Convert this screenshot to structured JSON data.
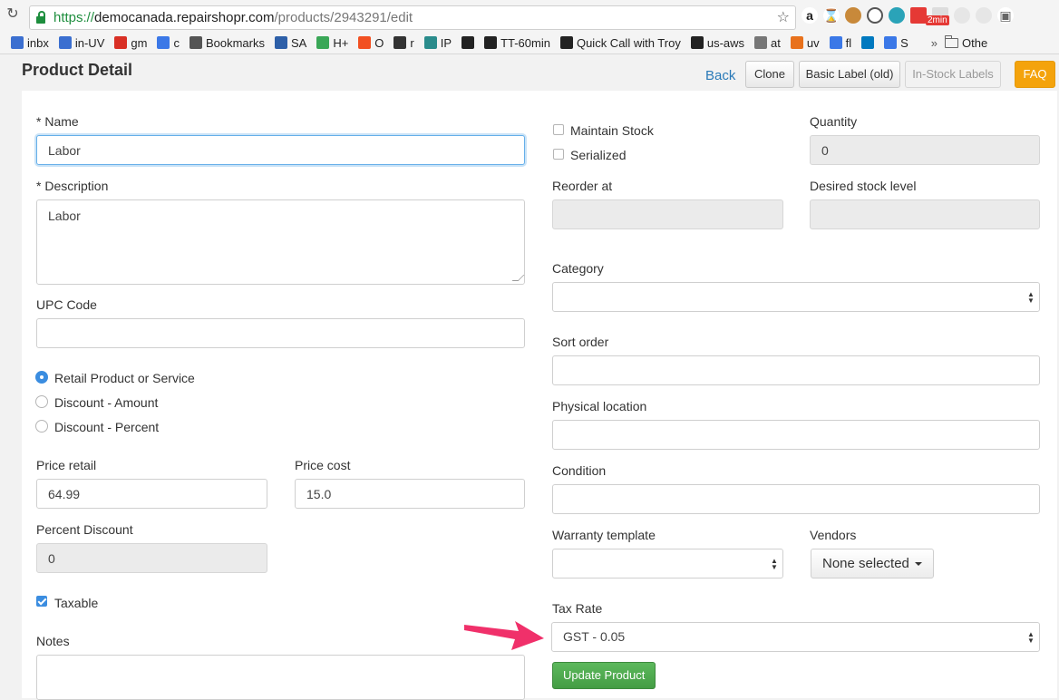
{
  "browser": {
    "url_scheme": "https://",
    "url_host": "democanada.repairshopr.com",
    "url_path": "/products/2943291/edit",
    "extension_badge": "2min",
    "bookmarks": [
      {
        "label": "inbx",
        "icon": "mail-icon",
        "color": "#3b6fd0"
      },
      {
        "label": "in-UV",
        "icon": "mail-icon",
        "color": "#3b6fd0"
      },
      {
        "label": "gm",
        "icon": "gmail-icon",
        "color": "#d93025"
      },
      {
        "label": "c",
        "icon": "calendar-icon",
        "color": "#3b78e7"
      },
      {
        "label": "Bookmarks",
        "icon": "star-icon",
        "color": "#555555"
      },
      {
        "label": "SA",
        "icon": "sa-icon",
        "color": "#2d5fa8"
      },
      {
        "label": "H+",
        "icon": "leaf-icon",
        "color": "#3aa757"
      },
      {
        "label": "O",
        "icon": "windows-icon",
        "color": "#f25022"
      },
      {
        "label": "r",
        "icon": "react-icon",
        "color": "#333333"
      },
      {
        "label": "IP",
        "icon": "pin-icon",
        "color": "#2a8c8c"
      },
      {
        "label": "",
        "icon": "square-icon",
        "color": "#222222"
      },
      {
        "label": "TT-60min",
        "icon": "tt-icon",
        "color": "#222222"
      },
      {
        "label": "Quick Call with Troy",
        "icon": "tt-icon",
        "color": "#222222"
      },
      {
        "label": "us-aws",
        "icon": "amazon-icon",
        "color": "#222222"
      },
      {
        "label": "at",
        "icon": "page-icon",
        "color": "#777777"
      },
      {
        "label": "uv",
        "icon": "uv-icon",
        "color": "#e8711c"
      },
      {
        "label": "fl",
        "icon": "cloud-icon",
        "color": "#3b78e7"
      },
      {
        "label": "",
        "icon": "trello-icon",
        "color": "#0079bf"
      },
      {
        "label": "S",
        "icon": "layout-icon",
        "color": "#3b78e7"
      }
    ],
    "more": "»",
    "other_bookmarks": "Othe"
  },
  "header": {
    "title": "Product Detail",
    "back": "Back",
    "clone": "Clone",
    "basic_label": "Basic Label (old)",
    "instock_labels": "In-Stock Labels",
    "faq": "FAQ"
  },
  "form": {
    "name_label": "* Name",
    "name_value": "Labor",
    "description_label": "* Description",
    "description_value": "Labor",
    "upc_label": "UPC Code",
    "upc_value": "",
    "product_types": [
      {
        "label": "Retail Product or Service",
        "selected": true
      },
      {
        "label": "Discount - Amount",
        "selected": false
      },
      {
        "label": "Discount - Percent",
        "selected": false
      }
    ],
    "price_retail_label": "Price retail",
    "price_retail_value": "64.99",
    "price_cost_label": "Price cost",
    "price_cost_value": "15.0",
    "percent_discount_label": "Percent Discount",
    "percent_discount_value": "0",
    "taxable_label": "Taxable",
    "taxable_checked": true,
    "notes_label": "Notes",
    "maintain_stock_label": "Maintain Stock",
    "serialized_label": "Serialized",
    "quantity_label": "Quantity",
    "quantity_value": "0",
    "reorder_label": "Reorder at",
    "desired_stock_label": "Desired stock level",
    "category_label": "Category",
    "sort_order_label": "Sort order",
    "physical_location_label": "Physical location",
    "condition_label": "Condition",
    "warranty_label": "Warranty template",
    "vendors_label": "Vendors",
    "vendors_value": "None selected",
    "tax_rate_label": "Tax Rate",
    "tax_rate_value": "GST - 0.05",
    "submit": "Update Product"
  },
  "colors": {
    "accent_blue": "#3b8de0",
    "link": "#2a7ab8",
    "faq_orange": "#f4a30c",
    "submit_green": "#5cb85c",
    "annotation_arrow": "#f0306a"
  }
}
